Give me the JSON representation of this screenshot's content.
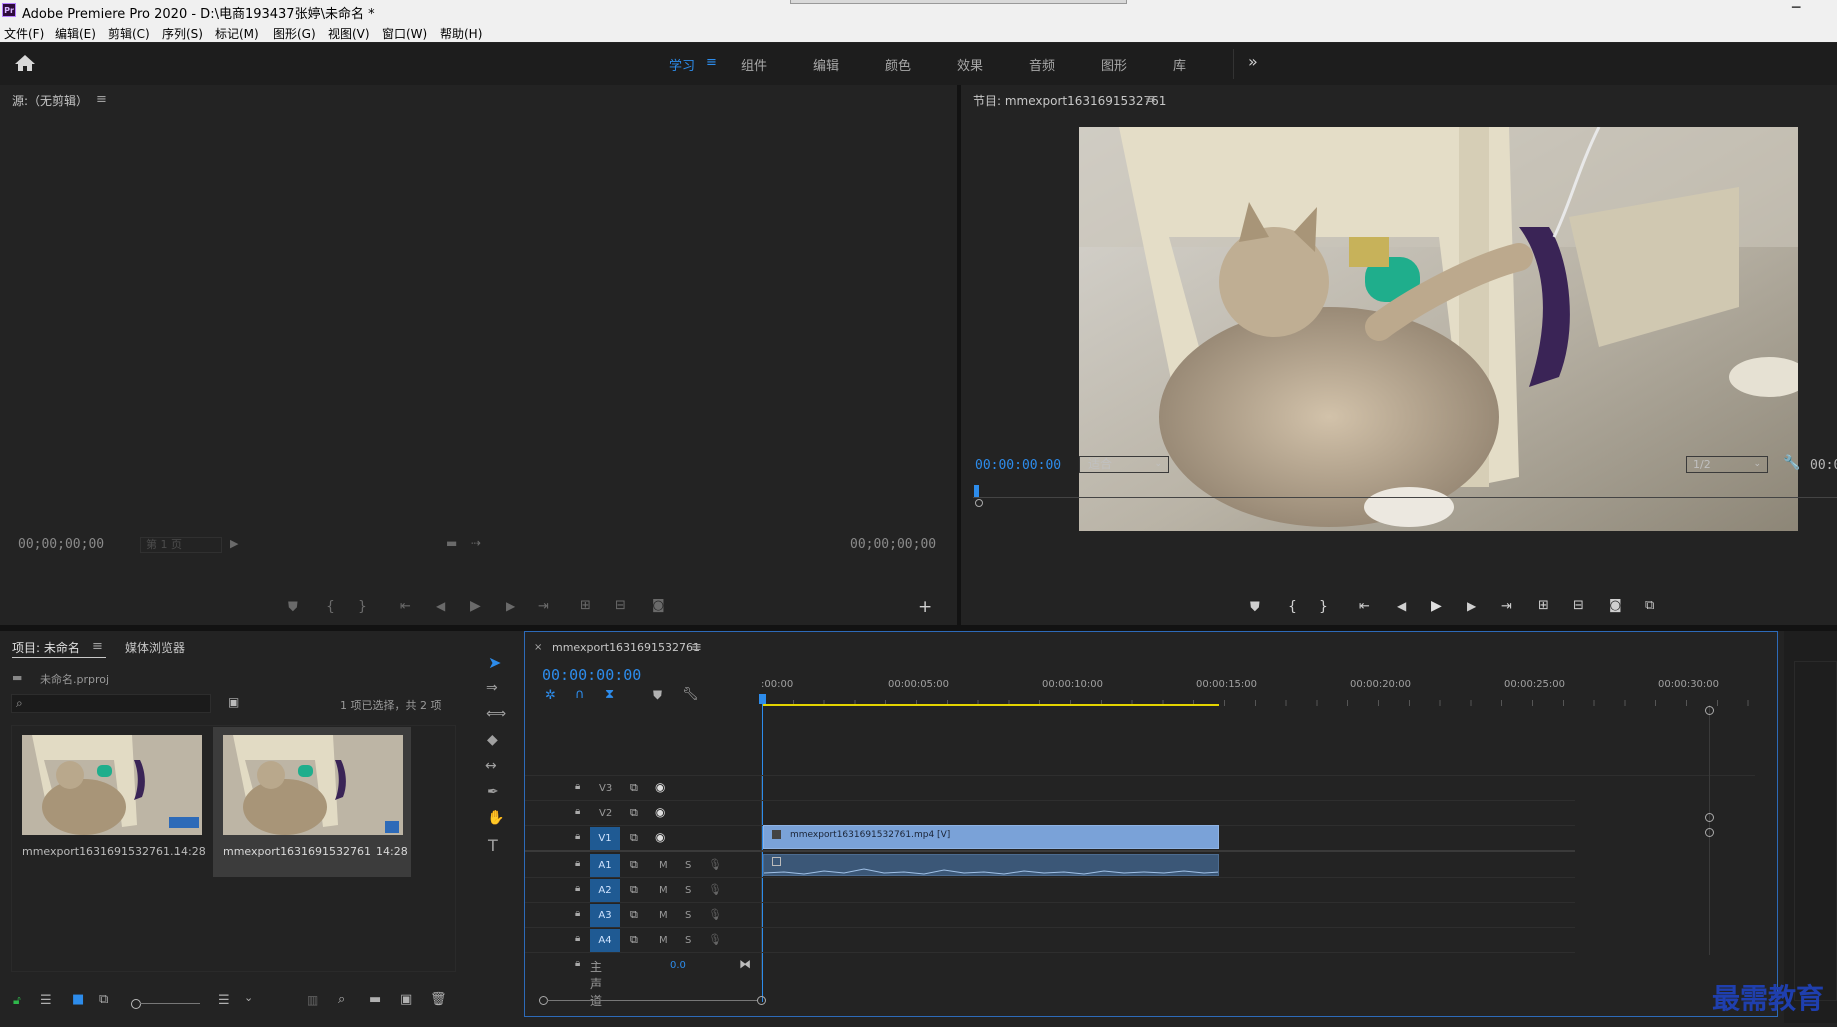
{
  "window": {
    "title": "Adobe Premiere Pro 2020 - D:\\电商193437张婷\\未命名 *",
    "app_icon": "Pr",
    "minimize": "─"
  },
  "menu": [
    "文件(F)",
    "编辑(E)",
    "剪辑(C)",
    "序列(S)",
    "标记(M)",
    "图形(G)",
    "视图(V)",
    "窗口(W)",
    "帮助(H)"
  ],
  "workspaces": {
    "items": [
      "学习",
      "组件",
      "编辑",
      "颜色",
      "效果",
      "音频",
      "图形",
      "库"
    ],
    "active": "学习",
    "menu_glyph": "≡",
    "more": "»"
  },
  "source": {
    "title": "源:（无剪辑）",
    "tc_left": "00;00;00;00",
    "tc_right": "00;00;00;00",
    "page": "第 1 页"
  },
  "program": {
    "title": "节目: mmexport1631691532761",
    "timecode": "00:00:00:00",
    "fit": "适合",
    "resolution": "1/2",
    "tc_right": "00:0"
  },
  "project": {
    "tab_active": "项目: 未命名",
    "tab_other": "媒体浏览器",
    "file": "未命名.prproj",
    "selection": "1 项已选择，共 2 项",
    "items": [
      {
        "name": "mmexport1631691532761...",
        "duration": "14:28"
      },
      {
        "name": "mmexport1631691532761",
        "duration": "14:28"
      }
    ]
  },
  "timeline": {
    "tab": "mmexport1631691532761",
    "timecode": "00:00:00:00",
    "ruler": [
      ":00:00",
      "00:00:05:00",
      "00:00:10:00",
      "00:00:15:00",
      "00:00:20:00",
      "00:00:25:00",
      "00:00:30:00"
    ],
    "video_tracks": [
      "V3",
      "V2",
      "V1"
    ],
    "audio_tracks": [
      "A1",
      "A2",
      "A3",
      "A4"
    ],
    "mute": "M",
    "solo": "S",
    "master": "主声道",
    "master_value": "0.0",
    "clip_video": "mmexport1631691532761.mp4 [V]"
  },
  "watermark": "最需教育",
  "colors": {
    "accent": "#2d8ceb",
    "clip_video": "#7aa2d8",
    "clip_audio": "#3b5777",
    "work_area": "#e3d300"
  }
}
